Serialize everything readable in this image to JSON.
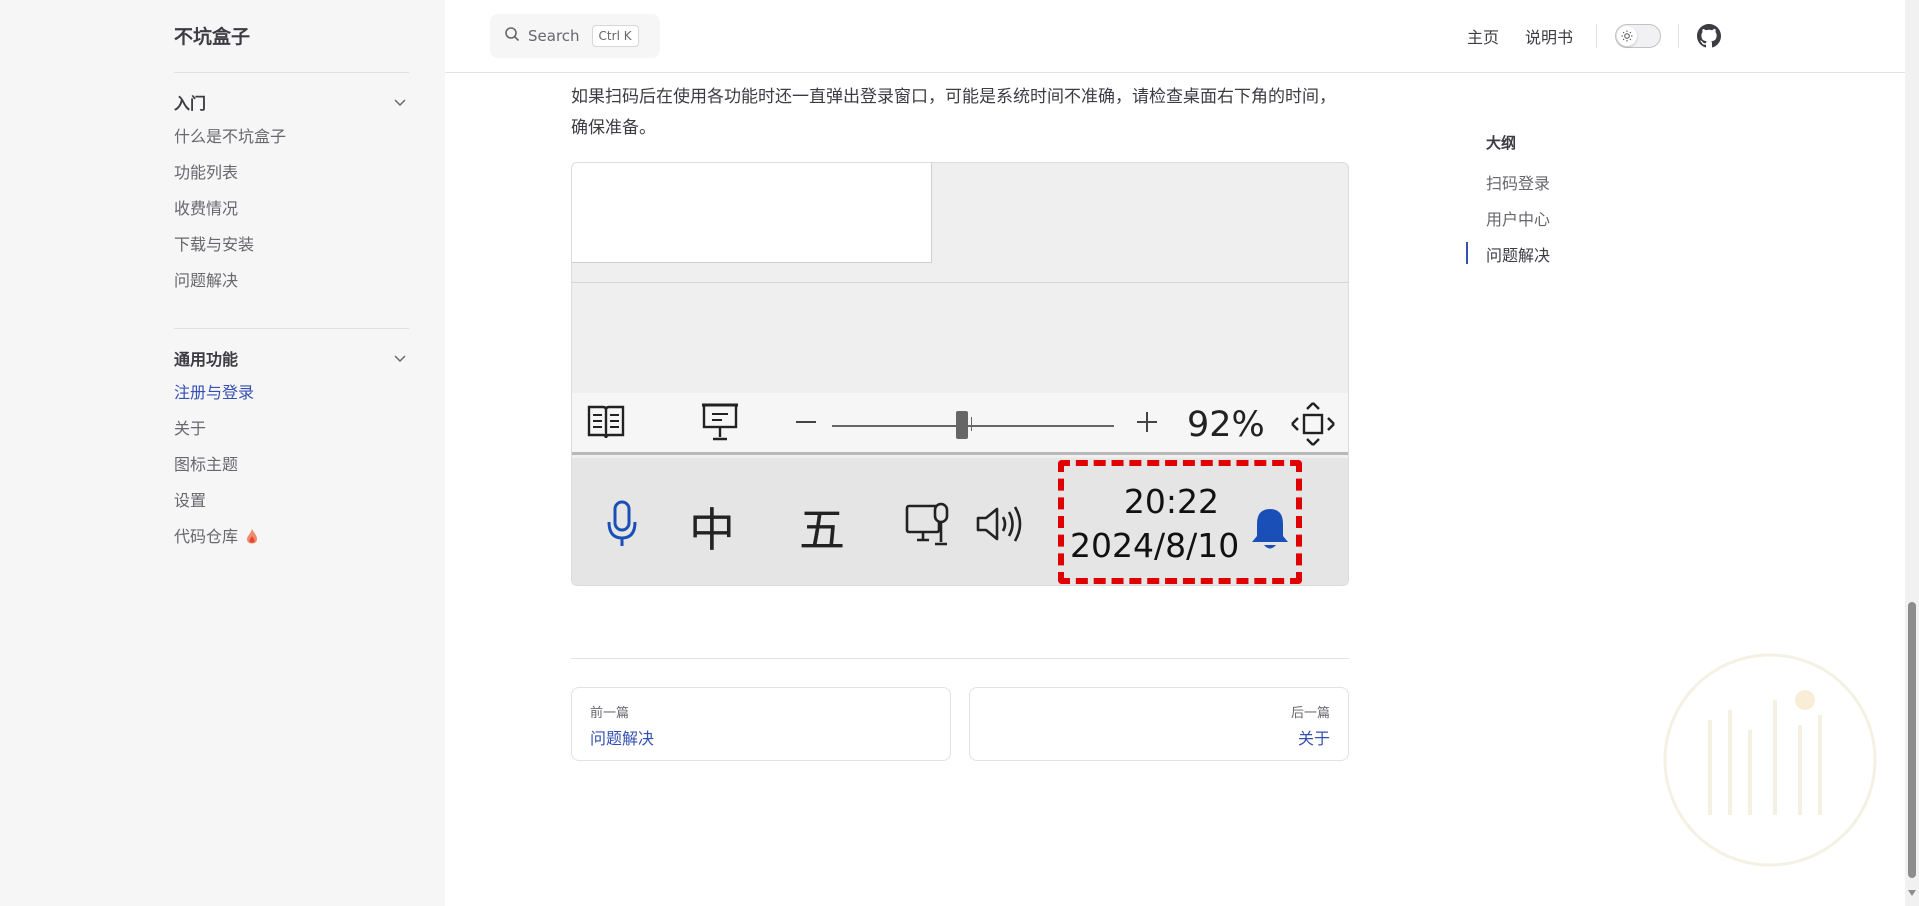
{
  "site": {
    "title": "不坑盒子"
  },
  "sidebar": {
    "groups": [
      {
        "title": "入门",
        "items": [
          "什么是不坑盒子",
          "功能列表",
          "收费情况",
          "下载与安装",
          "问题解决"
        ]
      },
      {
        "title": "通用功能",
        "items": [
          "注册与登录",
          "关于",
          "图标主题",
          "设置",
          "代码仓库"
        ]
      }
    ],
    "active_item": "注册与登录"
  },
  "topbar": {
    "search_label": "Search",
    "search_shortcut": "Ctrl K",
    "nav": [
      "主页",
      "说明书"
    ]
  },
  "content": {
    "paragraph": "如果扫码后在使用各功能时还一直弹出登录窗口，可能是系统时间不准确，请检查桌面右下角的时间，确保准备。",
    "screenshot": {
      "zoom_percent": "92%",
      "ime_mode": "中",
      "ime_name": "五",
      "time": "20:22",
      "date": "2024/8/10"
    }
  },
  "pager": {
    "prev": {
      "desc": "前一篇",
      "title": "问题解决"
    },
    "next": {
      "desc": "后一篇",
      "title": "关于"
    }
  },
  "outline": {
    "title": "大纲",
    "items": [
      "扫码登录",
      "用户中心",
      "问题解决"
    ],
    "active_item": "问题解决"
  },
  "colors": {
    "accent": "#3451b2",
    "highlight_box": "#e00000",
    "mic_blue": "#1a4fb8"
  }
}
